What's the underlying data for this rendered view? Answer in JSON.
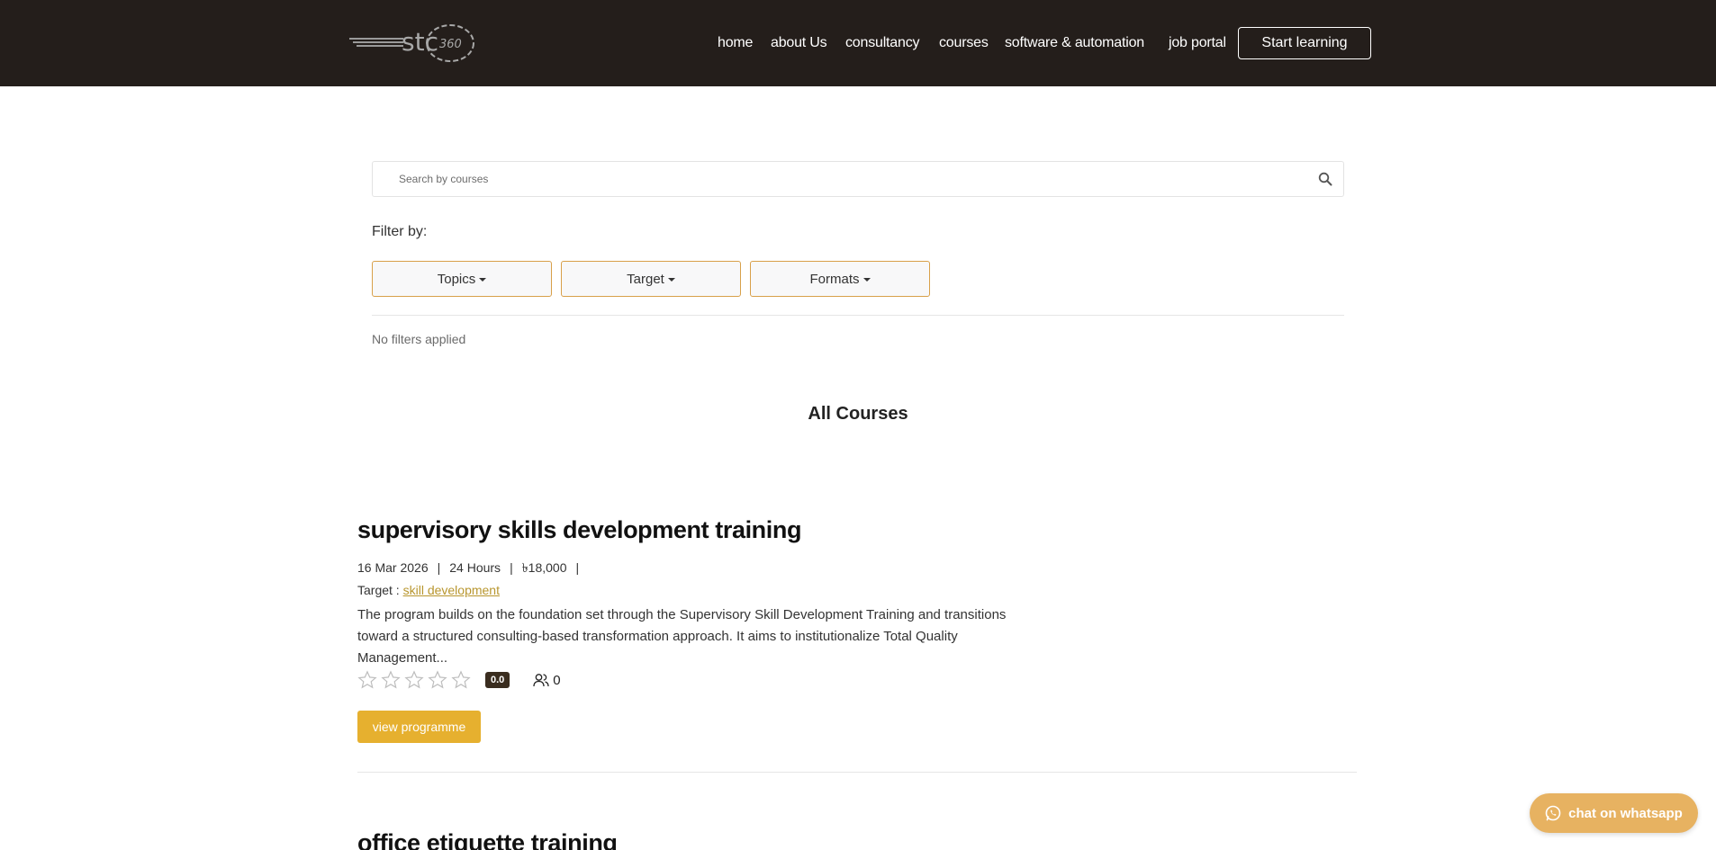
{
  "header": {
    "logo_text": "stc 360",
    "nav": [
      {
        "label": "home"
      },
      {
        "label": "about Us"
      },
      {
        "label": "consultancy"
      },
      {
        "label": "courses"
      },
      {
        "label": "software & automation"
      },
      {
        "label": "job portal"
      }
    ],
    "cta_label": "Start learning"
  },
  "search": {
    "placeholder": "Search by courses",
    "icon": "search-icon"
  },
  "filters": {
    "label": "Filter by:",
    "buttons": [
      {
        "label": "Topics"
      },
      {
        "label": "Target"
      },
      {
        "label": "Formats"
      }
    ],
    "status": "No filters applied"
  },
  "section_title": "All Courses",
  "courses": [
    {
      "title": "supervisory skills development training",
      "date": "16 Mar 2026",
      "duration": "24 Hours",
      "price": "৳18,000",
      "target_label": "Target :",
      "target_value": "skill development",
      "description": "The program builds on the foundation set through the Supervisory Skill Development Training and transitions toward a structured consulting-based transformation approach. It aims to institutionalize Total Quality Management...",
      "rating": "0.0",
      "stars_filled": 0,
      "stars_total": 5,
      "learners": "0",
      "button_label": "view programme"
    },
    {
      "title": "office etiquette training"
    }
  ],
  "whatsapp": {
    "label": "chat on whatsapp",
    "icon": "whatsapp-icon"
  },
  "colors": {
    "header_bg": "#241e1b",
    "accent": "#e6b02f",
    "filter_border": "#d8a04a",
    "whatsapp_bg": "#e7b261",
    "badge_bg": "#3a2d1f"
  }
}
